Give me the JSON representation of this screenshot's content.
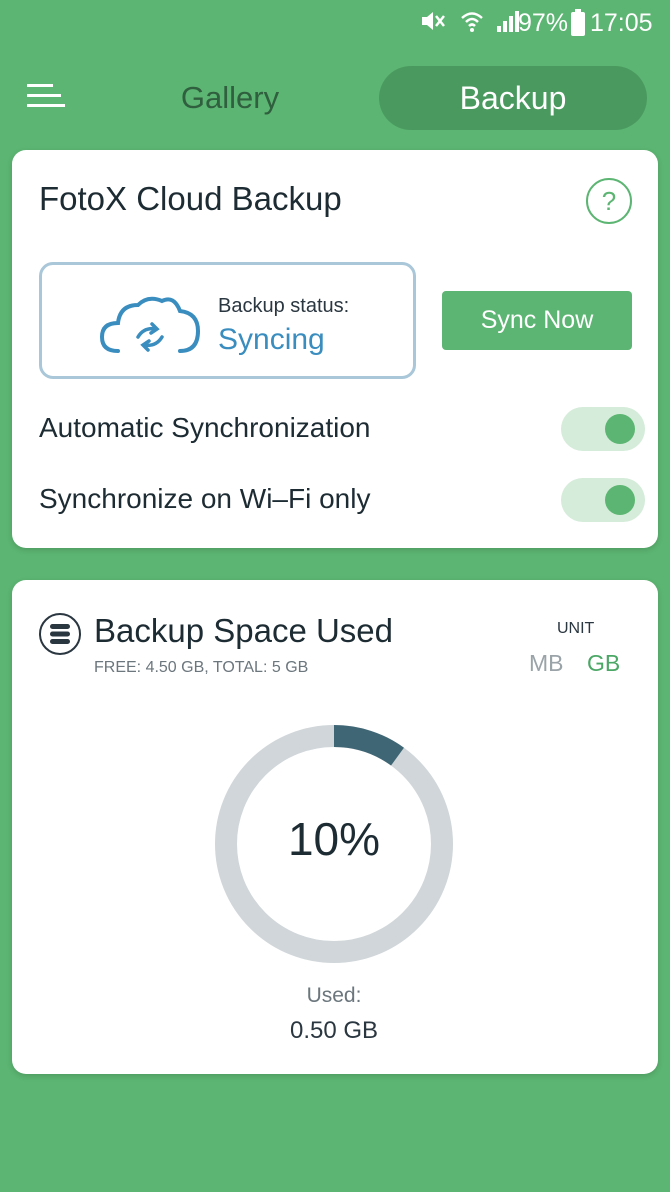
{
  "status_bar": {
    "battery": "97%",
    "time": "17:05",
    "icons": [
      "mute-icon",
      "wifi-icon",
      "signal-icon",
      "battery-icon"
    ]
  },
  "header": {
    "menu_icon": "menu-icon",
    "tabs": [
      {
        "label": "Gallery",
        "active": false
      },
      {
        "label": "Backup",
        "active": true
      }
    ]
  },
  "backup_card": {
    "title": "FotoX Cloud Backup",
    "help_label": "?",
    "status_label": "Backup status:",
    "status_value": "Syncing",
    "sync_button": "Sync Now",
    "settings": [
      {
        "label": "Automatic Synchronization",
        "on": true
      },
      {
        "label": "Synchronize on Wi–Fi only",
        "on": true
      }
    ]
  },
  "space_card": {
    "title": "Backup Space Used",
    "subtitle": "FREE: 4.50 GB, TOTAL: 5 GB",
    "unit_label": "UNIT",
    "units": [
      "MB",
      "GB"
    ],
    "selected_unit": "GB",
    "used_fraction": 0.1,
    "percent_text": "10%",
    "used_label": "Used:",
    "used_value": "0.50 GB"
  },
  "colors": {
    "background": "#5cb572",
    "accent": "#5cb572",
    "syncing": "#3a8dbf",
    "donut_used": "#3f6675",
    "donut_track": "#d0d6d9"
  }
}
